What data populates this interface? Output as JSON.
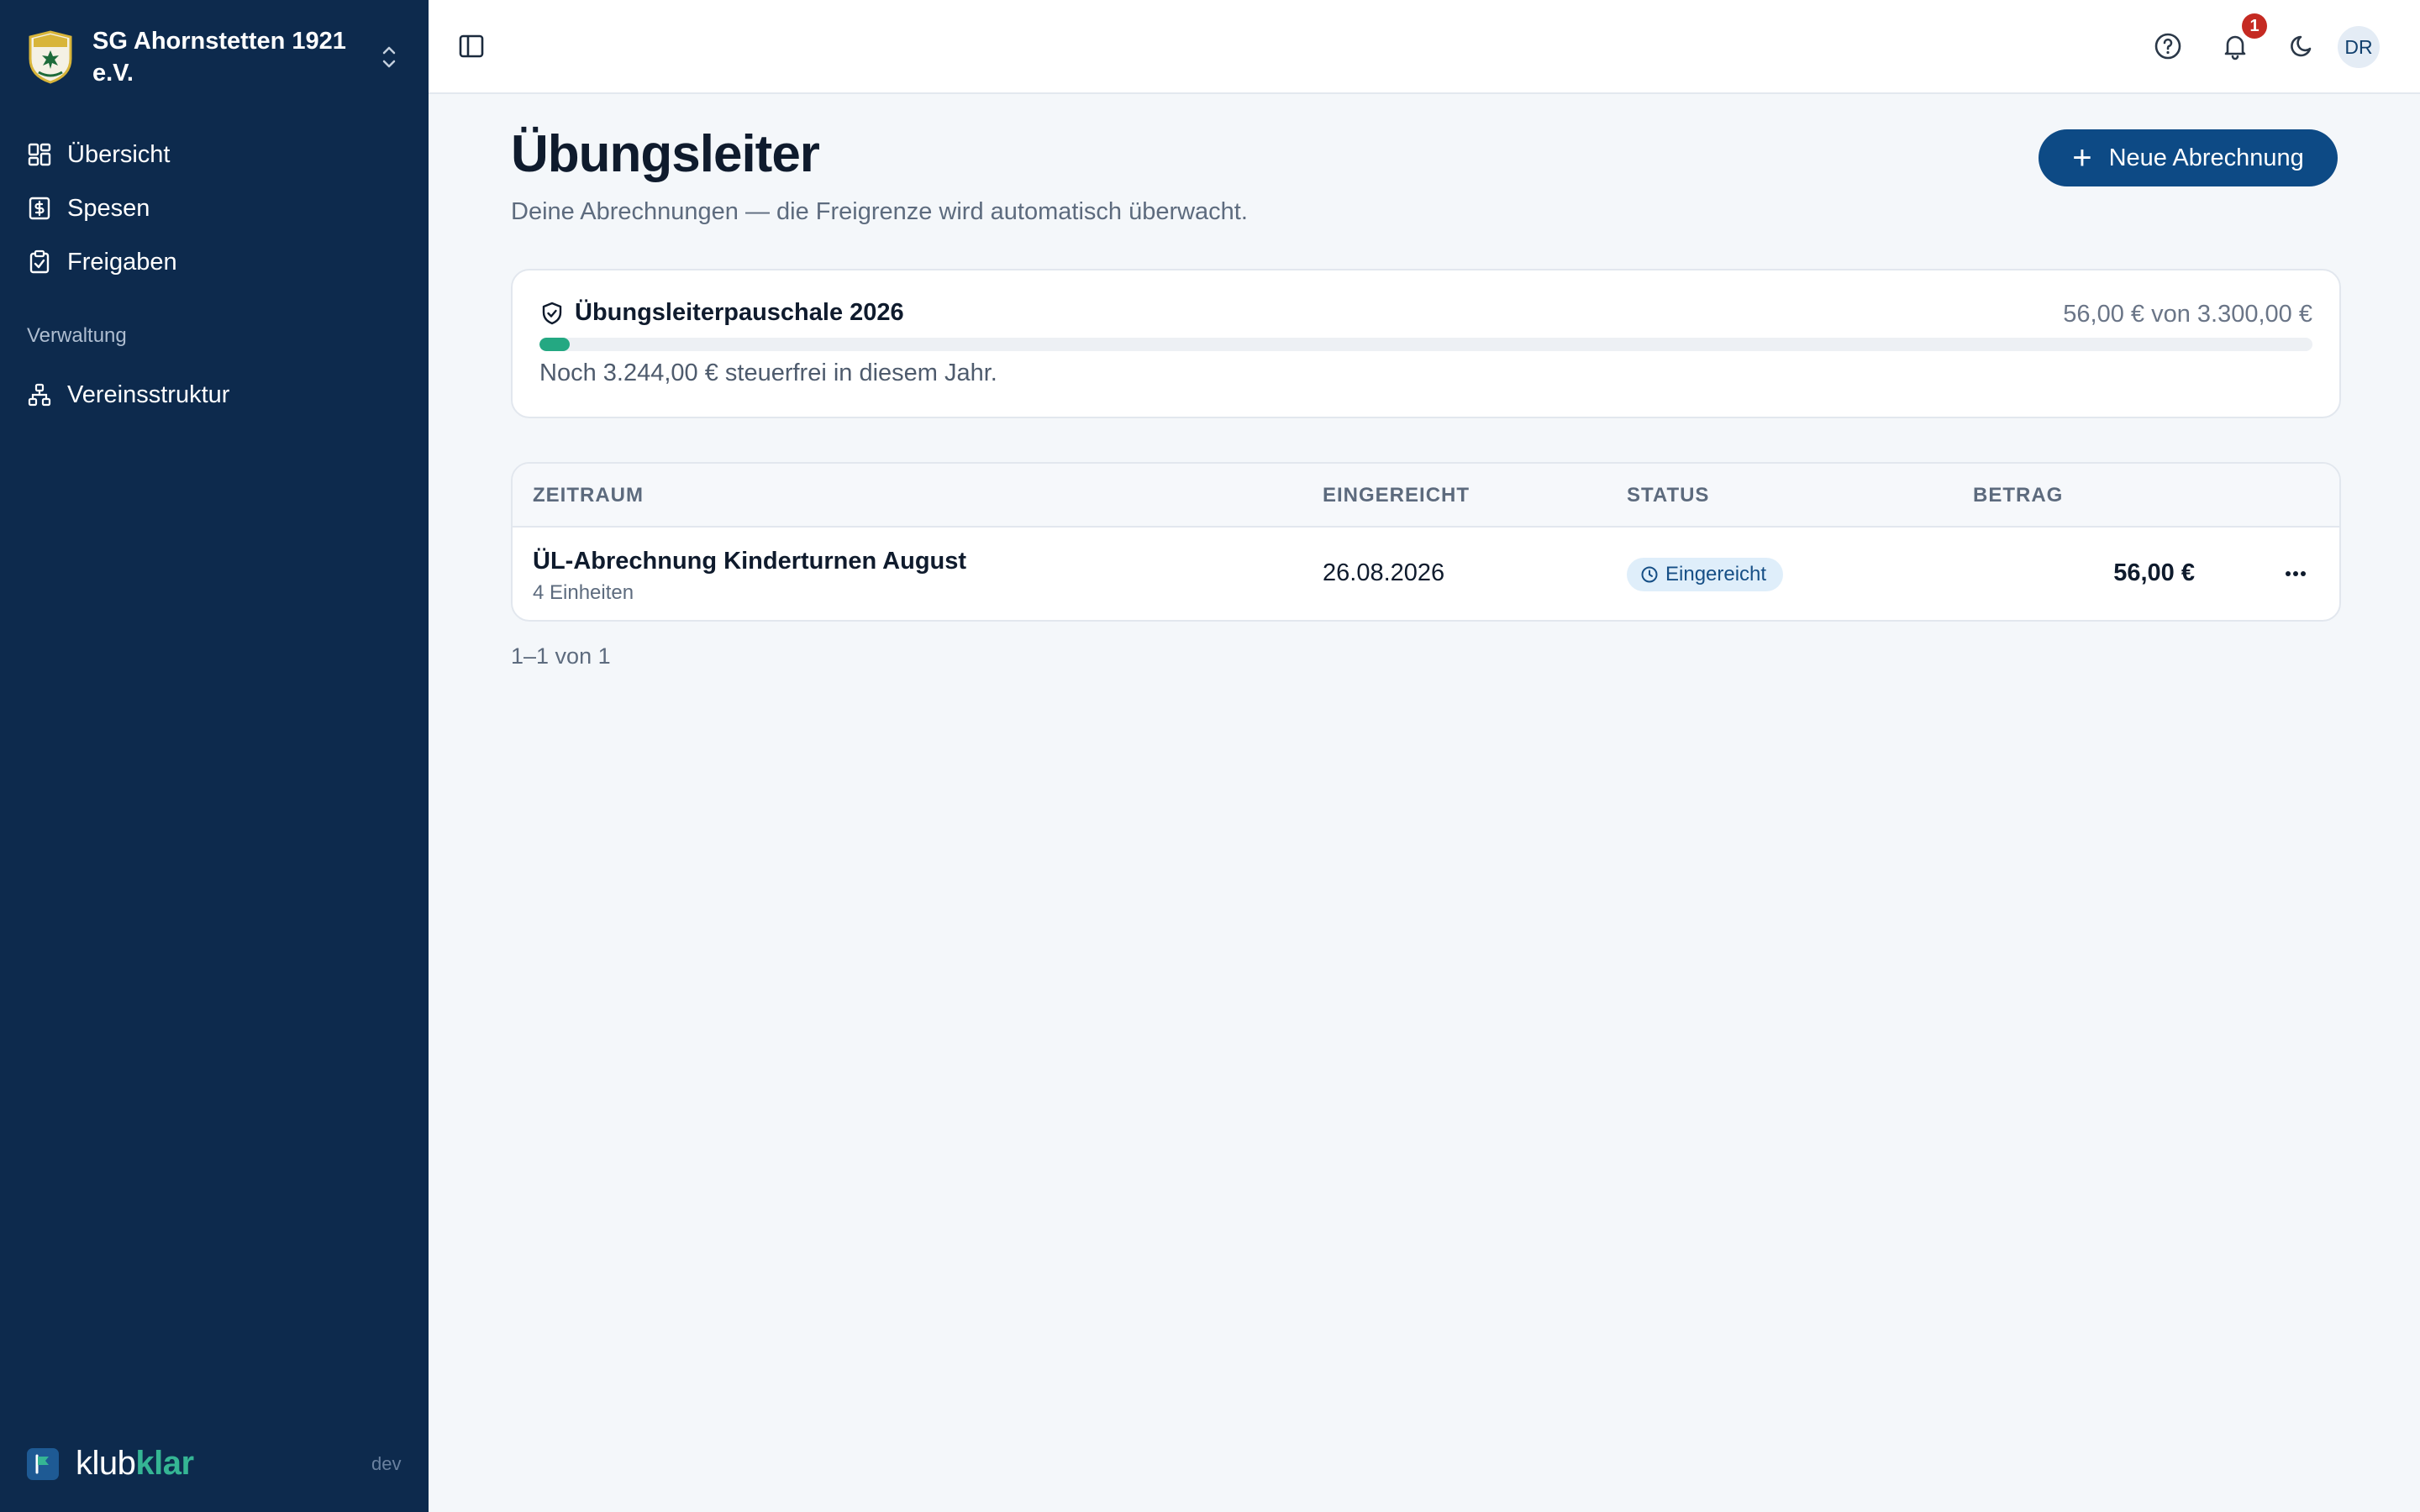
{
  "sidebar": {
    "club_name": "SG Ahornstetten 1921 e.V.",
    "nav": [
      {
        "label": "Übersicht",
        "icon": "dashboard-icon"
      },
      {
        "label": "Spesen",
        "icon": "receipt-icon"
      },
      {
        "label": "Freigaben",
        "icon": "clipboard-check-icon"
      }
    ],
    "section_label": "Verwaltung",
    "admin_nav": [
      {
        "label": "Vereinsstruktur",
        "icon": "org-structure-icon"
      }
    ],
    "brand": {
      "part1": "klub",
      "part2": "klar"
    },
    "env": "dev"
  },
  "topbar": {
    "notification_count": "1",
    "avatar_initials": "DR"
  },
  "page": {
    "title": "Übungsleiter",
    "subtitle": "Deine Abrechnungen — die Freigrenze wird automatisch überwacht.",
    "new_button": "Neue Abrechnung"
  },
  "quota": {
    "title": "Übungsleiterpauschale 2026",
    "amount": "56,00 € von 3.300,00 €",
    "progress_percent": 1.7,
    "note": "Noch 3.244,00 € steuerfrei in diesem Jahr."
  },
  "table": {
    "headers": [
      "ZEITRAUM",
      "EINGEREICHT",
      "STATUS",
      "BETRAG"
    ],
    "rows": [
      {
        "title": "ÜL-Abrechnung Kinderturnen August",
        "subtitle": "4 Einheiten",
        "date": "26.08.2026",
        "status": "Eingereicht",
        "amount": "56,00 €"
      }
    ]
  },
  "pagination": "1–1 von 1",
  "colors": {
    "sidebar_bg": "#0d2a4d",
    "accent": "#0d4a85",
    "progress": "#24a882",
    "badge": "#c52a22"
  }
}
